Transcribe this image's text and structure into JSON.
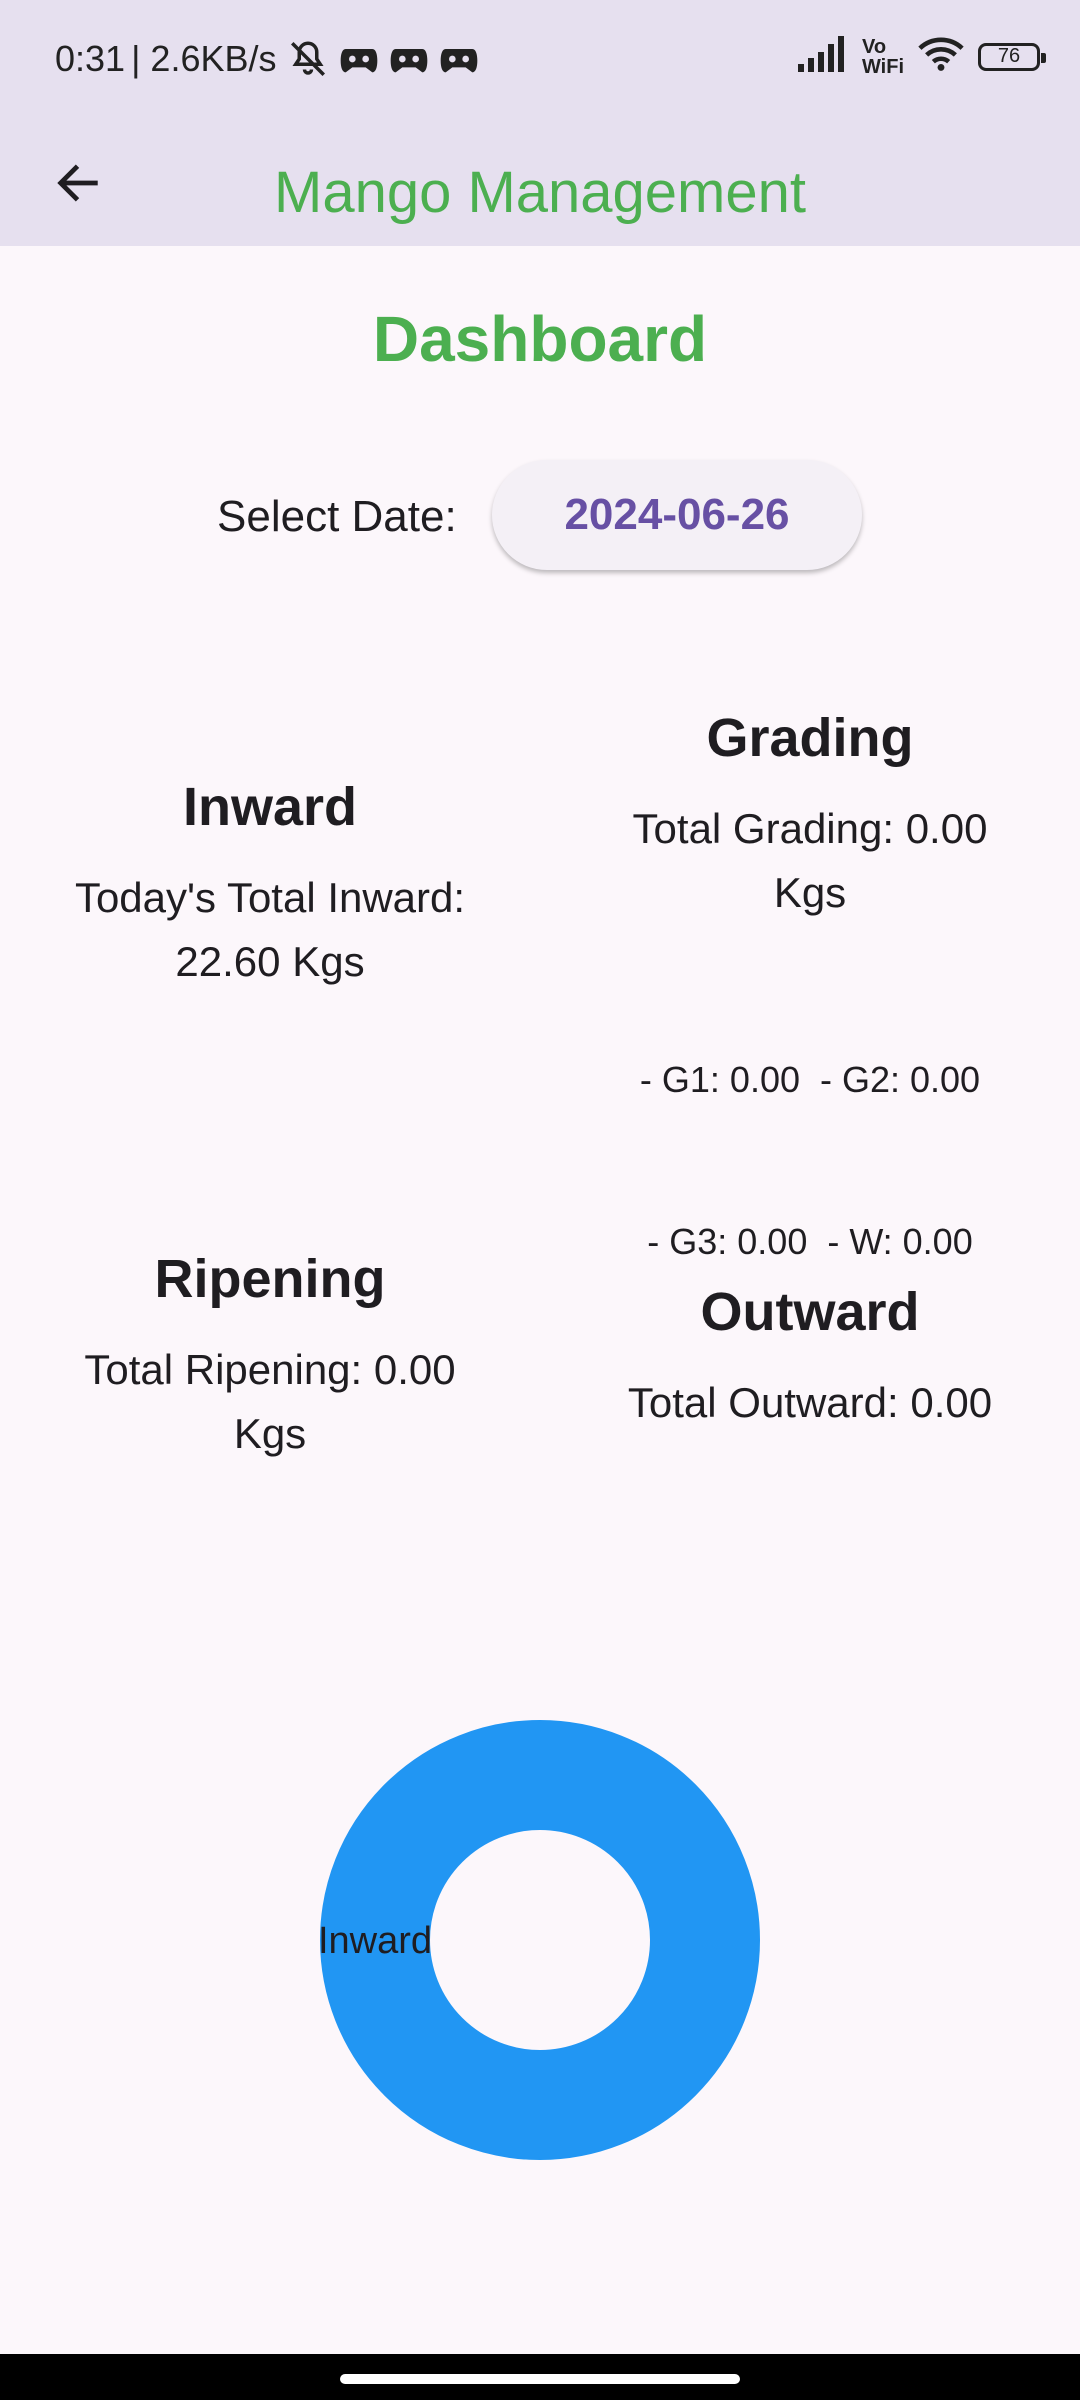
{
  "status_bar": {
    "time": "0:31",
    "speed": "| 2.6KB/s",
    "vowifi_top": "Vo",
    "vowifi_bottom": "WiFi",
    "battery": "76",
    "icons": [
      "mute-bell-icon",
      "game-controller-icon",
      "game-controller-icon",
      "game-controller-icon",
      "signal-icon",
      "wifi-icon",
      "battery-icon"
    ]
  },
  "app_bar": {
    "back_icon": "arrow-back-icon",
    "title": "Mango Management"
  },
  "dashboard": {
    "title": "Dashboard",
    "date_label": "Select Date:",
    "date_value": "2024-06-26"
  },
  "inward": {
    "title": "Inward",
    "line1": "Today's Total Inward:",
    "line2": "22.60 Kgs"
  },
  "grading": {
    "title": "Grading",
    "line1": "Total Grading: 0.00",
    "line2": "Kgs",
    "sub1": "- G1: 0.00  - G2: 0.00",
    "sub2": "- G3: 0.00  - W: 0.00"
  },
  "ripening": {
    "title": "Ripening",
    "line1": "Total Ripening: 0.00",
    "line2": "Kgs"
  },
  "outward": {
    "title": "Outward",
    "line1": "Total Outward: 0.00"
  },
  "colors": {
    "accent_green": "#4caf50",
    "accent_purple": "#6750a4",
    "chart_blue": "#2196f3"
  },
  "chart_data": {
    "type": "pie",
    "categories": [
      "Inward"
    ],
    "values": [
      22.6
    ],
    "donut": true,
    "slice_labels": [
      "Inward"
    ],
    "colors": [
      "#2196f3"
    ]
  }
}
